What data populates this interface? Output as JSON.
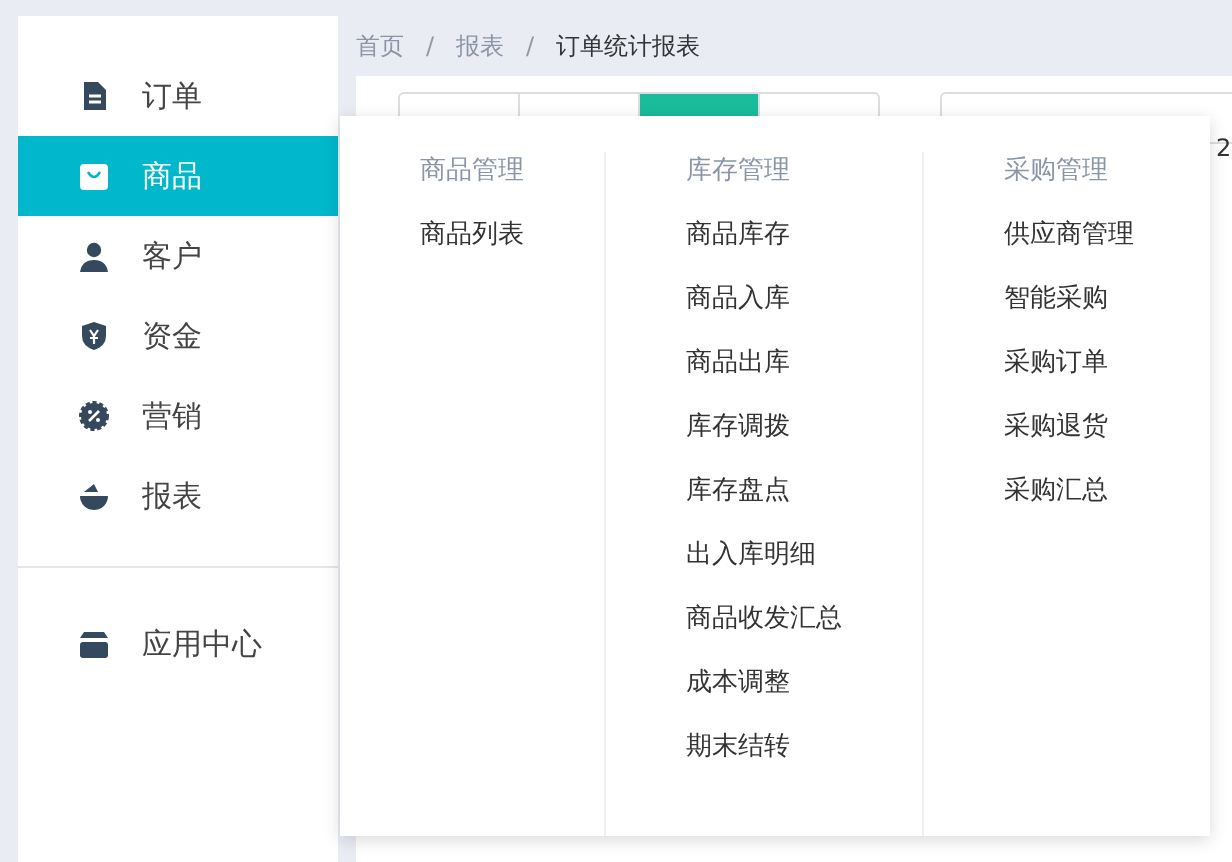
{
  "sidebar": {
    "groups": [
      {
        "items": [
          {
            "label": "订单",
            "kind": "document",
            "selected": false
          },
          {
            "label": "商品",
            "kind": "bag",
            "selected": true
          },
          {
            "label": "客户",
            "kind": "person",
            "selected": false
          },
          {
            "label": "资金",
            "kind": "shield",
            "selected": false
          },
          {
            "label": "营销",
            "kind": "badge",
            "selected": false
          },
          {
            "label": "报表",
            "kind": "chart",
            "selected": false
          }
        ]
      },
      {
        "items": [
          {
            "label": "应用中心",
            "kind": "store",
            "selected": false
          }
        ]
      }
    ]
  },
  "breadcrumb": [
    {
      "kind": "link",
      "text": "首页"
    },
    {
      "kind": "separator",
      "text": "/"
    },
    {
      "kind": "link",
      "text": "报表"
    },
    {
      "kind": "separator",
      "text": "/"
    },
    {
      "kind": "current",
      "text": "订单统计报表"
    }
  ],
  "toolbar": {
    "segments": [
      {
        "selected": false
      },
      {
        "selected": false
      },
      {
        "selected": true
      },
      {
        "selected": false
      }
    ],
    "date_field": {
      "value": "2"
    }
  },
  "mega_menu": {
    "columns": [
      {
        "title": "商品管理",
        "items": [
          "商品列表"
        ]
      },
      {
        "title": "库存管理",
        "items": [
          "商品库存",
          "商品入库",
          "商品出库",
          "库存调拨",
          "库存盘点",
          "出入库明细",
          "商品收发汇总",
          "成本调整",
          "期末结转"
        ]
      },
      {
        "title": "采购管理",
        "items": [
          "供应商管理",
          "智能采购",
          "采购订单",
          "采购退货",
          "采购汇总"
        ]
      }
    ]
  }
}
